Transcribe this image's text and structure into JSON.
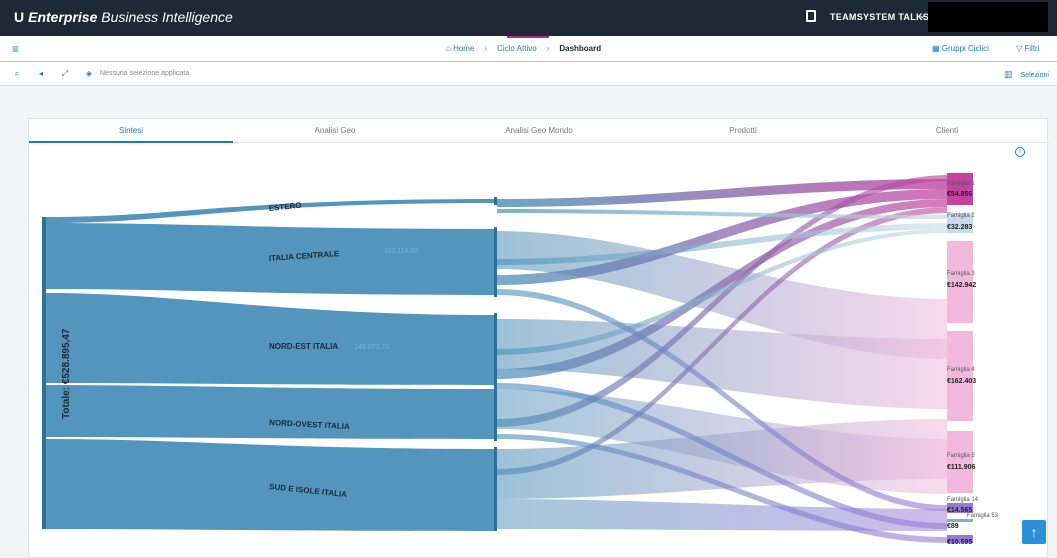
{
  "header": {
    "logo": "U",
    "brand_bold": "Enterprise",
    "brand_rest": " Business Intelligence",
    "tenant": "TEAMSYSTEM TALKS",
    "tenant_chevron": "⌄"
  },
  "nav": {
    "menu_icon": "≡",
    "breadcrumbs": [
      "Home",
      "Ciclo Attivo",
      "Dashboard"
    ],
    "gruppi_label": "Gruppi Ciclici",
    "filtri_label": "Filtri"
  },
  "toolbar": {
    "selection_text": "Nessuna selezione applicata",
    "selezioni_label": "Selezioni"
  },
  "tabs": [
    "Sintesi",
    "Analisi Geo",
    "Analisi Geo Mondo",
    "Prodotti",
    "Clienti"
  ],
  "active_tab": "Sintesi",
  "sankey": {
    "total_label": "Totale: €528.895,47",
    "regions": [
      {
        "name": "ESTERO",
        "color": "#4a8fb8"
      },
      {
        "name": "ITALIA CENTRALE",
        "value_label": "110.114,58",
        "color": "#4a8fb8"
      },
      {
        "name": "NORD-EST ITALIA",
        "value_label": "149.072,73",
        "color": "#4a8fb8"
      },
      {
        "name": "NORD-OVEST ITALIA",
        "color": "#4a8fb8"
      },
      {
        "name": "SUD E ISOLE ITALIA",
        "color": "#4a8fb8"
      }
    ],
    "families": [
      {
        "label": "Famiglia 1",
        "value": "€54.856",
        "color": "#c2449f"
      },
      {
        "label": "Famiglia 2",
        "value": "€32.283",
        "color": "#c7dce8"
      },
      {
        "label": "Famiglia 3",
        "value": "€142.942",
        "color": "#f3b9dd"
      },
      {
        "label": "Famiglia 4",
        "value": "€162.403",
        "color": "#f3b9dd"
      },
      {
        "label": "Famiglia 5",
        "value": "€111.906",
        "color": "#f3b9dd"
      },
      {
        "label": "Famiglia 14",
        "value": "€14.565",
        "color": "#9a78d8"
      },
      {
        "label": "Famiglia 53",
        "value": "€89",
        "color": "#7fb0d0"
      },
      {
        "label": "",
        "value": "€10.595",
        "color": "#9a78d8"
      }
    ]
  },
  "colors": {
    "topbar": "#1f2935",
    "accent": "#1a7dc0",
    "source": "#4a8fb8"
  }
}
